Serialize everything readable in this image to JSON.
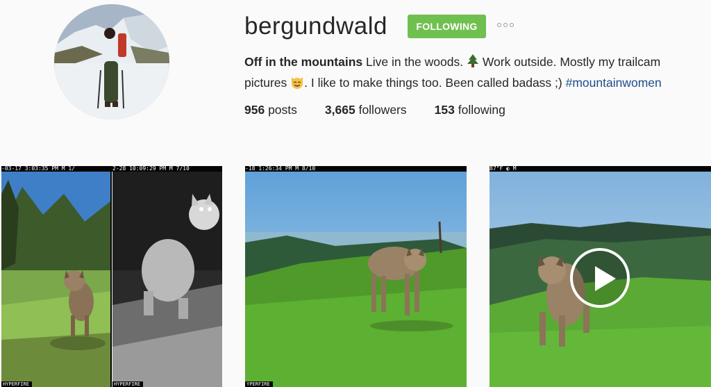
{
  "profile": {
    "username": "bergundwald",
    "follow_label": "FOLLOWING",
    "bio_bold": "Off in the mountains",
    "bio_line1": " Live in the woods. ",
    "bio_line2": " Work outside. Mostly my trailcam pictures ",
    "bio_line3": ". I like to make things too. Been called badass ;) ",
    "bio_hashtag": "#mountainwomen",
    "emoji_tree": "tree-emoji",
    "emoji_cat": "cat-emoji"
  },
  "stats": {
    "posts_count": "956",
    "posts_label": "posts",
    "followers_count": "3,665",
    "followers_label": "followers",
    "following_count": "153",
    "following_label": "following"
  },
  "posts": [
    {
      "cam_left": "-03-17 3:03:35 PM    M 1/",
      "cam_right": "2-28 10:09:29 PM    M 7/10",
      "footer_left": "HYPERFIRE",
      "footer_right": "HYPERFIRE"
    },
    {
      "cam": "-18 1:26:34 PM    M 8/10",
      "footer": "YPERFIRE"
    },
    {
      "cam": "87°F ◐    M",
      "has_video": true
    }
  ],
  "colors": {
    "follow_bg": "#70c050",
    "hashtag": "#1b4d8a",
    "text": "#262626"
  }
}
